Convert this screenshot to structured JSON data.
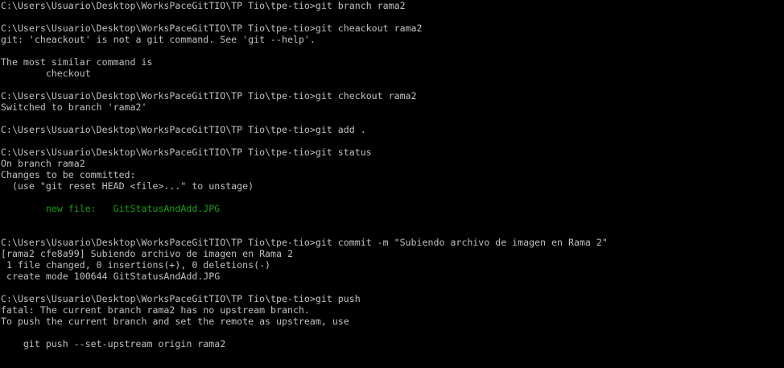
{
  "terminal": {
    "colors": {
      "background": "#000000",
      "foreground": "#c0c0c0",
      "staged_file": "#13a10e"
    },
    "lines": [
      {
        "text": "C:\\Users\\Usuario\\Desktop\\WorksPaceGitTIO\\TP Tio\\tpe-tio>git branch rama2",
        "style": "normal"
      },
      {
        "text": "",
        "style": "normal"
      },
      {
        "text": "C:\\Users\\Usuario\\Desktop\\WorksPaceGitTIO\\TP Tio\\tpe-tio>git cheackout rama2",
        "style": "normal"
      },
      {
        "text": "git: 'cheackout' is not a git command. See 'git --help'.",
        "style": "normal"
      },
      {
        "text": "",
        "style": "normal"
      },
      {
        "text": "The most similar command is",
        "style": "normal"
      },
      {
        "text": "        checkout",
        "style": "normal"
      },
      {
        "text": "",
        "style": "normal"
      },
      {
        "text": "C:\\Users\\Usuario\\Desktop\\WorksPaceGitTIO\\TP Tio\\tpe-tio>git checkout rama2",
        "style": "normal"
      },
      {
        "text": "Switched to branch 'rama2'",
        "style": "normal"
      },
      {
        "text": "",
        "style": "normal"
      },
      {
        "text": "C:\\Users\\Usuario\\Desktop\\WorksPaceGitTIO\\TP Tio\\tpe-tio>git add .",
        "style": "normal"
      },
      {
        "text": "",
        "style": "normal"
      },
      {
        "text": "C:\\Users\\Usuario\\Desktop\\WorksPaceGitTIO\\TP Tio\\tpe-tio>git status",
        "style": "normal"
      },
      {
        "text": "On branch rama2",
        "style": "normal"
      },
      {
        "text": "Changes to be committed:",
        "style": "normal"
      },
      {
        "text": "  (use \"git reset HEAD <file>...\" to unstage)",
        "style": "normal"
      },
      {
        "text": "",
        "style": "normal"
      },
      {
        "text": "        new file:   GitStatusAndAdd.JPG",
        "style": "green"
      },
      {
        "text": "",
        "style": "normal"
      },
      {
        "text": "",
        "style": "normal"
      },
      {
        "text": "C:\\Users\\Usuario\\Desktop\\WorksPaceGitTIO\\TP Tio\\tpe-tio>git commit -m \"Subiendo archivo de imagen en Rama 2\"",
        "style": "normal"
      },
      {
        "text": "[rama2 cfe8a99] Subiendo archivo de imagen en Rama 2",
        "style": "normal"
      },
      {
        "text": " 1 file changed, 0 insertions(+), 0 deletions(-)",
        "style": "normal"
      },
      {
        "text": " create mode 100644 GitStatusAndAdd.JPG",
        "style": "normal"
      },
      {
        "text": "",
        "style": "normal"
      },
      {
        "text": "C:\\Users\\Usuario\\Desktop\\WorksPaceGitTIO\\TP Tio\\tpe-tio>git push",
        "style": "normal"
      },
      {
        "text": "fatal: The current branch rama2 has no upstream branch.",
        "style": "normal"
      },
      {
        "text": "To push the current branch and set the remote as upstream, use",
        "style": "normal"
      },
      {
        "text": "",
        "style": "normal"
      },
      {
        "text": "    git push --set-upstream origin rama2",
        "style": "normal"
      },
      {
        "text": "",
        "style": "normal"
      }
    ]
  }
}
